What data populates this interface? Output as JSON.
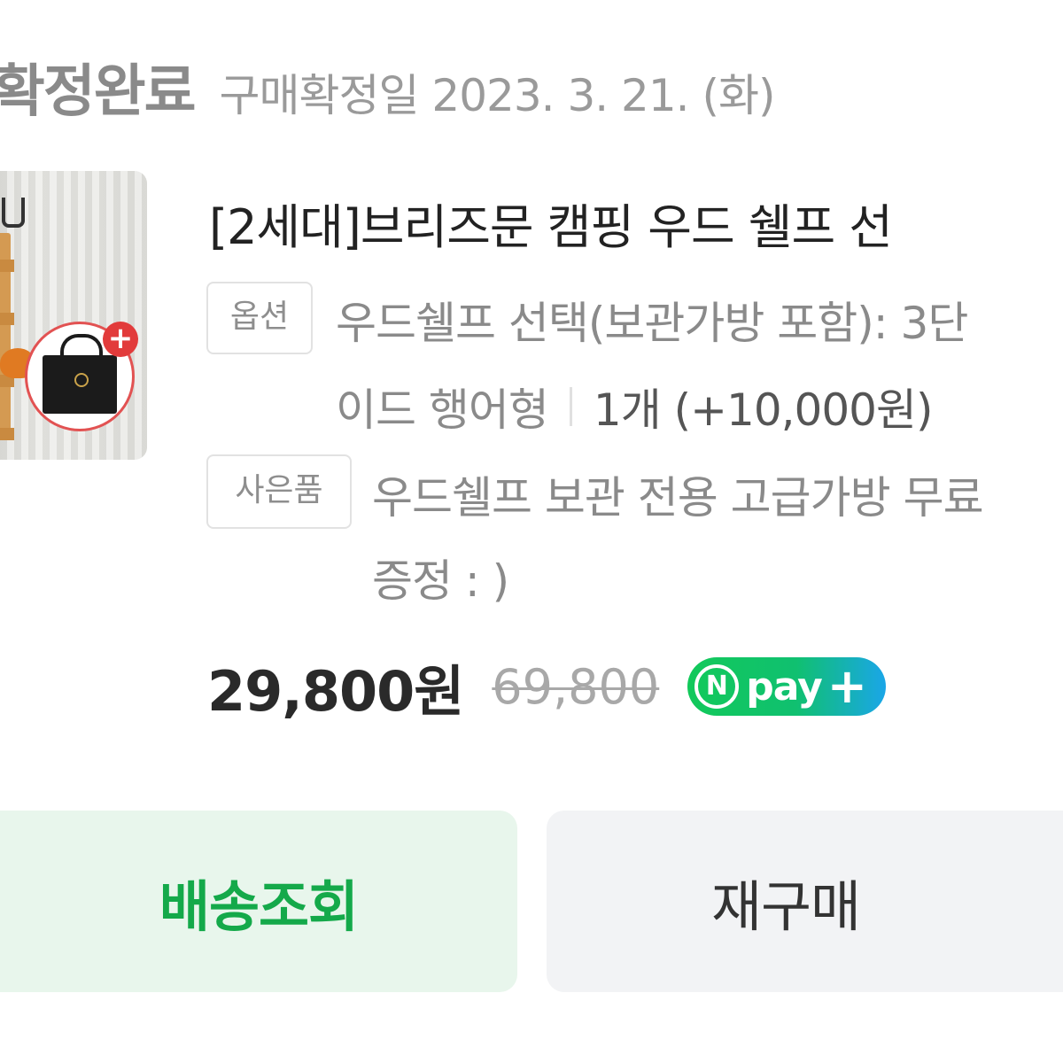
{
  "status": {
    "title": "확정완료",
    "date_text": "구매확정일 2023. 3. 21. (화)"
  },
  "product": {
    "thumbnail_alt": "product-thumbnail",
    "title": "[2세대]브리즈문 캠핑 우드 쉘프 선",
    "option_tag": "옵션",
    "option_line1": "우드쉘프 선택(보관가방 포함): 3단",
    "option_line2_name": "이드 행어형",
    "option_quantity": "1개 (+10,000원)",
    "gift_tag": "사은품",
    "gift_line1": "우드쉘프 보관 전용 고급가방 무료",
    "gift_line2": "증정 : )"
  },
  "price": {
    "current": "29,800원",
    "original": "69,800",
    "npay_n": "N",
    "npay_label": "pay",
    "npay_plus": "+"
  },
  "buttons": {
    "track_label": "배송조회",
    "rebuy_label": "재구매"
  },
  "colors": {
    "accent_green": "#14a94a",
    "track_bg": "#e8f6ec",
    "rebuy_bg": "#f2f3f5",
    "badge_red": "#e23b3b"
  }
}
